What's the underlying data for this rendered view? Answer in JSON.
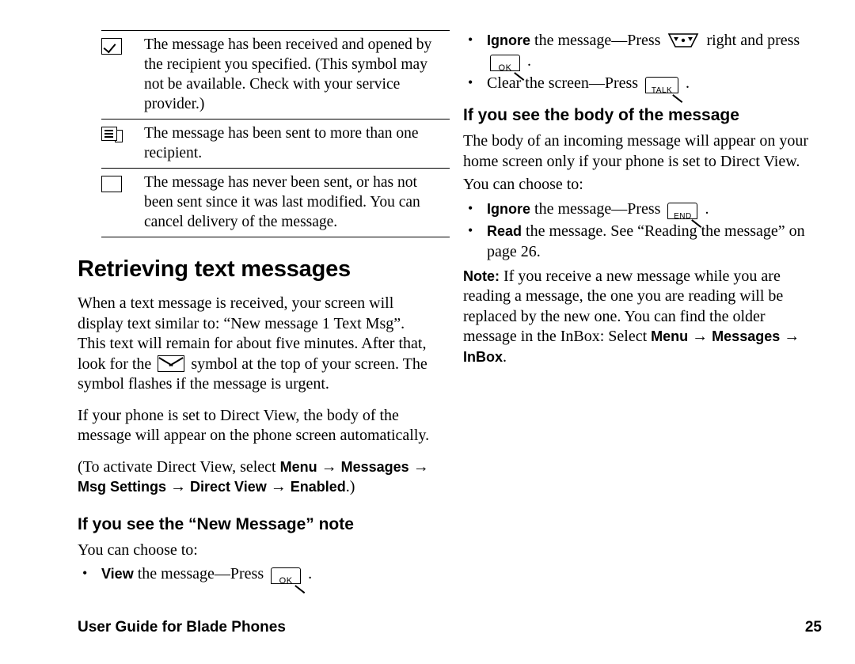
{
  "symbol_table": {
    "rows": [
      {
        "icon": "checked-box-icon",
        "text": "The message has been received and opened by the recipient you specified. (This symbol may not be available. Check with your service provider.)"
      },
      {
        "icon": "multiple-recipients-icon",
        "text": "The message has been sent to more than one recipient."
      },
      {
        "icon": "empty-box-icon",
        "text": "The message has never been sent, or has not been sent since it was last modified. You can cancel delivery of the message."
      }
    ]
  },
  "left": {
    "section_heading": "Retrieving text messages",
    "para1": "When a text message is received, your screen will display text similar to: “New message 1 Text Msg”. This text will remain for about five minutes. After that, look for the",
    "para1_cont": "symbol at the top of your screen. The symbol flashes if the message is urgent.",
    "para2": "If your phone is set to Direct View, the body of the message will appear on the phone screen automatically.",
    "para3_pre": "(To activate Direct View, select ",
    "para3_menu": "Menu",
    "para3_messages": "Messages",
    "para3_msgsettings": "Msg Settings",
    "para3_directview": "Direct View",
    "para3_enabled": "Enabled",
    "para3_close": ".)",
    "sub_heading": "If you see the “New Message” note",
    "choose": "You can choose to:",
    "bullet_view_bold": "View",
    "bullet_view_rest": "the message—Press",
    "bullet_view_end": "."
  },
  "right": {
    "bullet_ignore_bold": "Ignore",
    "bullet_ignore_rest": "the message—Press",
    "bullet_ignore_mid": "right and press",
    "bullet_ignore_end": ".",
    "bullet_clear": "Clear the screen—Press",
    "bullet_clear_end": ".",
    "sub_heading": "If you see the body of the message",
    "para1": "The body of an incoming message will appear on your home screen only if your phone is set to Direct View.",
    "choose": "You can choose to:",
    "bullet_ignore2_bold": "Ignore",
    "bullet_ignore2_rest": "the message—Press",
    "bullet_ignore2_end": ".",
    "bullet_read_bold": "Read",
    "bullet_read_rest": "the message. See “Reading the message” on page 26.",
    "note_label": "Note:",
    "note_text": "If you receive a new message while you are reading a message, the one you are reading will be replaced by the new one. You can find the older message in the InBox: Select",
    "note_menu": "Menu",
    "note_messages": "Messages",
    "note_inbox": "InBox",
    "note_period": "."
  },
  "keys": {
    "ok_label": "OK",
    "talk_label": "TALK",
    "end_label": "END"
  },
  "footer": {
    "text": "User Guide for Blade Phones",
    "page": "25"
  }
}
